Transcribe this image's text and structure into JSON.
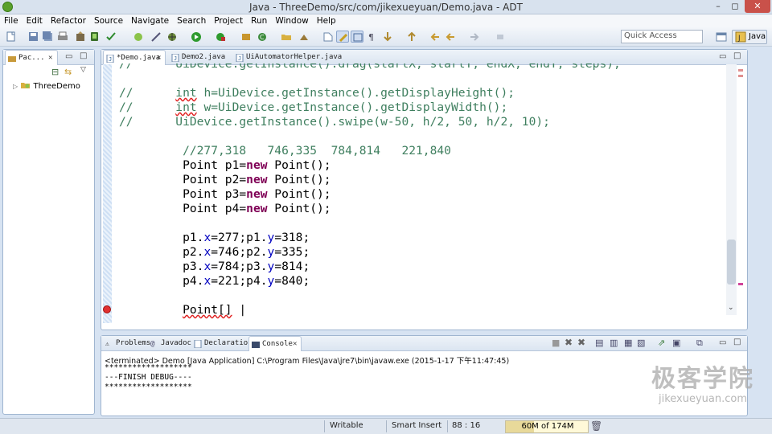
{
  "window": {
    "title": "Java - ThreeDemo/src/com/jikexueyuan/Demo.java - ADT",
    "minimize": "–",
    "restore": "◻",
    "close": "✕"
  },
  "menu": [
    "File",
    "Edit",
    "Refactor",
    "Source",
    "Navigate",
    "Search",
    "Project",
    "Run",
    "Window",
    "Help"
  ],
  "toolbar": {
    "quick_access_placeholder": "Quick Access",
    "perspective": "Java"
  },
  "package_explorer": {
    "tab": "Pac...",
    "tree": [
      {
        "label": "ThreeDemo"
      }
    ]
  },
  "editor": {
    "tabs": [
      {
        "label": "*Demo.java",
        "active": true
      },
      {
        "label": "Demo2.java",
        "active": false
      },
      {
        "label": "UiAutomatorHelper.java",
        "active": false
      }
    ],
    "lines": [
      [
        {
          "t": "//      UiDevice.getInstance().drag(startX, startY, endX, endY, steps);",
          "c": "cmt"
        }
      ],
      [],
      [
        {
          "t": "//",
          "c": "cmt"
        },
        {
          "t": "      "
        },
        {
          "t": "int",
          "c": "cmt err"
        },
        {
          "t": " h=UiDevice.getInstance().getDisplayHeight();",
          "c": "cmt"
        }
      ],
      [
        {
          "t": "//",
          "c": "cmt"
        },
        {
          "t": "      "
        },
        {
          "t": "int",
          "c": "cmt err"
        },
        {
          "t": " w=UiDevice.getInstance().getDisplayWidth();",
          "c": "cmt"
        }
      ],
      [
        {
          "t": "//      UiDevice.getInstance().swipe(w-50, h/2, 50, h/2, 10);",
          "c": "cmt"
        }
      ],
      [],
      [
        {
          "t": "         "
        },
        {
          "t": "//277,318   746,335  784,814   221,840",
          "c": "cmt"
        }
      ],
      [
        {
          "t": "         Point p1="
        },
        {
          "t": "new",
          "c": "kw"
        },
        {
          "t": " Point();"
        }
      ],
      [
        {
          "t": "         Point p2="
        },
        {
          "t": "new",
          "c": "kw"
        },
        {
          "t": " Point();"
        }
      ],
      [
        {
          "t": "         Point p3="
        },
        {
          "t": "new",
          "c": "kw"
        },
        {
          "t": " Point();"
        }
      ],
      [
        {
          "t": "         Point p4="
        },
        {
          "t": "new",
          "c": "kw"
        },
        {
          "t": " Point();"
        }
      ],
      [],
      [
        {
          "t": "         p1."
        },
        {
          "t": "x",
          "c": "fld"
        },
        {
          "t": "=277;p1."
        },
        {
          "t": "y",
          "c": "fld"
        },
        {
          "t": "=318;"
        }
      ],
      [
        {
          "t": "         p2."
        },
        {
          "t": "x",
          "c": "fld"
        },
        {
          "t": "=746;p2."
        },
        {
          "t": "y",
          "c": "fld"
        },
        {
          "t": "=335;"
        }
      ],
      [
        {
          "t": "         p3."
        },
        {
          "t": "x",
          "c": "fld"
        },
        {
          "t": "=784;p3."
        },
        {
          "t": "y",
          "c": "fld"
        },
        {
          "t": "=814;"
        }
      ],
      [
        {
          "t": "         p4."
        },
        {
          "t": "x",
          "c": "fld"
        },
        {
          "t": "=221;p4."
        },
        {
          "t": "y",
          "c": "fld"
        },
        {
          "t": "=840;"
        }
      ],
      [],
      [
        {
          "t": "         "
        },
        {
          "t": "Point[]",
          "c": "err"
        },
        {
          "t": " |"
        }
      ]
    ]
  },
  "bottom_tabs": [
    {
      "label": "Problems",
      "active": false
    },
    {
      "label": "Javadoc",
      "active": false
    },
    {
      "label": "Declaration",
      "active": false
    },
    {
      "label": "Console",
      "active": true
    }
  ],
  "console": {
    "status": "<terminated> Demo [Java Application] C:\\Program Files\\Java\\jre7\\bin\\javaw.exe (2015-1-17 下午11:47:45)",
    "lines": [
      "*******************",
      "---FINISH DEBUG----",
      "*******************"
    ]
  },
  "watermark": {
    "cn": "极客学院",
    "url": "jikexueyuan.com"
  },
  "status": {
    "writable": "Writable",
    "insert_mode": "Smart Insert",
    "position": "88 : 16",
    "heap": "60M of 174M",
    "heap_fraction": 0.345
  }
}
